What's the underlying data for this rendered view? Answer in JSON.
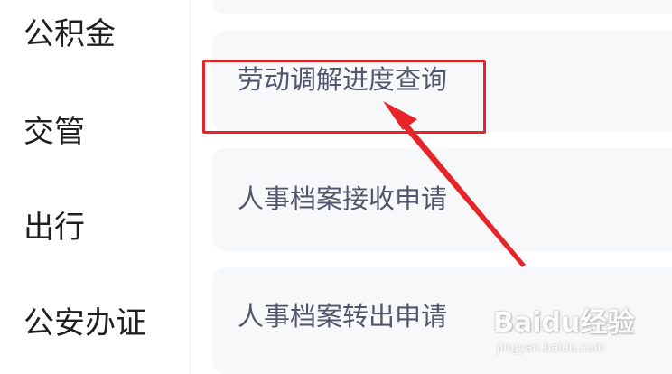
{
  "sidebar": {
    "items": [
      {
        "label": "公积金"
      },
      {
        "label": "交管"
      },
      {
        "label": "出行"
      },
      {
        "label": "公安办证"
      }
    ]
  },
  "services": {
    "items": [
      {
        "label": ""
      },
      {
        "label": "劳动调解进度查询",
        "highlighted": true
      },
      {
        "label": "人事档案接收申请"
      },
      {
        "label": "人事档案转出申请"
      }
    ]
  },
  "annotation": {
    "box_color": "#e5252a",
    "arrow_color": "#e5252a"
  },
  "watermark": {
    "brand": "Baidu经验",
    "url": "jingyan.baidu.com"
  },
  "colors": {
    "card_bg": "#f7f8fa",
    "card_text": "#50566b",
    "sidebar_text": "#1f1f1f"
  }
}
